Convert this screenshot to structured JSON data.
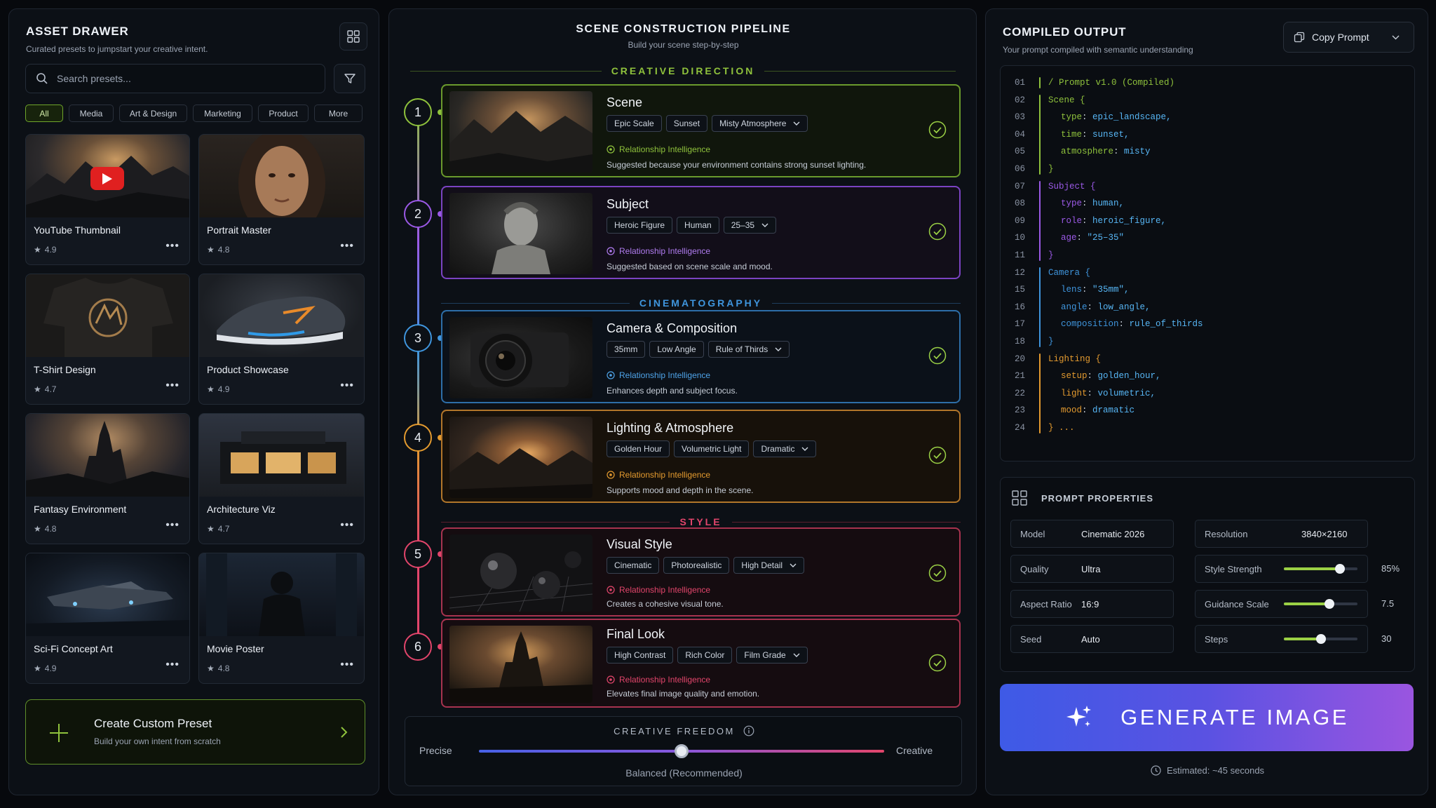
{
  "left": {
    "title": "ASSET DRAWER",
    "subtitle": "Curated presets to jumpstart your creative intent.",
    "search_placeholder": "Search presets...",
    "filters": [
      "All",
      "Media",
      "Art & Design",
      "Marketing",
      "Product",
      "More"
    ],
    "active_filter": "All",
    "presets": [
      {
        "name": "YouTube Thumbnail",
        "rating": "4.9"
      },
      {
        "name": "Portrait Master",
        "rating": "4.8"
      },
      {
        "name": "T-Shirt Design",
        "rating": "4.7"
      },
      {
        "name": "Product Showcase",
        "rating": "4.9"
      },
      {
        "name": "Fantasy Environment",
        "rating": "4.8"
      },
      {
        "name": "Architecture Viz",
        "rating": "4.7"
      },
      {
        "name": "Sci-Fi Concept Art",
        "rating": "4.9"
      },
      {
        "name": "Movie Poster",
        "rating": "4.8"
      }
    ],
    "more_glyph": "•••",
    "create": {
      "title": "Create Custom Preset",
      "subtitle": "Build your own intent from scratch"
    }
  },
  "center": {
    "title": "SCENE CONSTRUCTION PIPELINE",
    "subtitle": "Build your scene step-by-step",
    "sections": [
      "CREATIVE DIRECTION",
      "CINEMATOGRAPHY",
      "STYLE"
    ],
    "ri_label": "Relationship Intelligence",
    "steps": [
      {
        "num": "1",
        "title": "Scene",
        "tags": [
          "Epic Scale",
          "Sunset"
        ],
        "dropdown": "Misty Atmosphere",
        "suggestion": "Suggested because your environment contains strong sunset lighting.",
        "color": "#8fc23c"
      },
      {
        "num": "2",
        "title": "Subject",
        "tags": [
          "Heroic Figure",
          "Human"
        ],
        "dropdown": "25–35",
        "suggestion": "Suggested based on scene scale and mood.",
        "color": "#9b59e6"
      },
      {
        "num": "3",
        "title": "Camera & Composition",
        "tags": [
          "35mm",
          "Low Angle"
        ],
        "dropdown": "Rule of Thirds",
        "suggestion": "Enhances depth and subject focus.",
        "color": "#3f95dd"
      },
      {
        "num": "4",
        "title": "Lighting & Atmosphere",
        "tags": [
          "Golden Hour",
          "Volumetric Light"
        ],
        "dropdown": "Dramatic",
        "suggestion": "Supports mood and depth in the scene.",
        "color": "#e39a2f"
      },
      {
        "num": "5",
        "title": "Visual Style",
        "tags": [
          "Cinematic",
          "Photorealistic"
        ],
        "dropdown": "High Detail",
        "suggestion": "Creates a cohesive visual tone.",
        "color": "#e2456b"
      },
      {
        "num": "6",
        "title": "Final Look",
        "tags": [
          "High Contrast",
          "Rich Color"
        ],
        "dropdown": "Film Grade",
        "suggestion": "Elevates final image quality and emotion.",
        "color": "#e2456b"
      }
    ],
    "freedom": {
      "title": "CREATIVE FREEDOM",
      "left": "Precise",
      "right": "Creative",
      "value_label": "Balanced (Recommended)",
      "value": 0.5
    }
  },
  "right": {
    "title": "COMPILED OUTPUT",
    "subtitle": "Your prompt compiled with semantic understanding",
    "copy_label": "Copy Prompt",
    "code": [
      {
        "n": "01",
        "t": "/ Prompt v1.0 (Compiled)"
      },
      {
        "n": "02",
        "t": "Scene {"
      },
      {
        "n": "03",
        "k": "type",
        "v": "epic_landscape,"
      },
      {
        "n": "04",
        "k": "time",
        "v": "sunset,"
      },
      {
        "n": "05",
        "k": "atmosphere",
        "v": "misty"
      },
      {
        "n": "06",
        "t": "}"
      },
      {
        "n": "07",
        "t": "Subject {"
      },
      {
        "n": "08",
        "k": "type",
        "v": "human,"
      },
      {
        "n": "09",
        "k": "role",
        "v": "heroic_figure,"
      },
      {
        "n": "10",
        "k": "age",
        "v": "\"25–35\""
      },
      {
        "n": "11",
        "t": "}"
      },
      {
        "n": "12",
        "t": "Camera {"
      },
      {
        "n": "15",
        "k": "lens",
        "v": "\"35mm\","
      },
      {
        "n": "16",
        "k": "angle",
        "v": "low_angle,"
      },
      {
        "n": "17",
        "k": "composition",
        "v": "rule_of_thirds"
      },
      {
        "n": "18",
        "t": "}"
      },
      {
        "n": "20",
        "t": "Lighting {"
      },
      {
        "n": "21",
        "k": "setup",
        "v": "golden_hour,"
      },
      {
        "n": "22",
        "k": "light",
        "v": "volumetric,"
      },
      {
        "n": "23",
        "k": "mood",
        "v": "dramatic"
      },
      {
        "n": "24",
        "t": "} ..."
      }
    ],
    "props_title": "PROMPT PROPERTIES",
    "props": {
      "model": {
        "k": "Model",
        "v": "Cinematic 2026"
      },
      "quality": {
        "k": "Quality",
        "v": "Ultra"
      },
      "aspect": {
        "k": "Aspect Ratio",
        "v": "16:9"
      },
      "seed": {
        "k": "Seed",
        "v": "Auto"
      },
      "resolution": {
        "k": "Resolution",
        "v": "3840×2160"
      }
    },
    "sliders": [
      {
        "k": "Style Strength",
        "v": "85%",
        "frac": 0.76
      },
      {
        "k": "Guidance Scale",
        "v": "7.5",
        "frac": 0.62
      },
      {
        "k": "Steps",
        "v": "30",
        "frac": 0.5
      }
    ],
    "generate_label": "GENERATE IMAGE",
    "estimated": "Estimated: ~45 seconds"
  },
  "colors": {
    "accent_green": "#8fc23c",
    "accent_purple": "#9b59e6",
    "accent_blue": "#3f95dd",
    "accent_orange": "#e39a2f",
    "accent_pink": "#e2456b"
  }
}
